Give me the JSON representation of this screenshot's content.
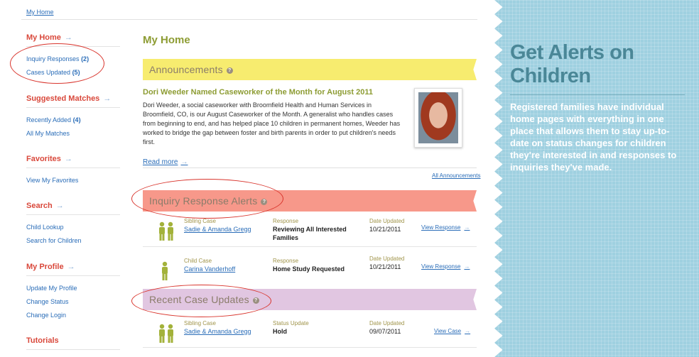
{
  "breadcrumb": "My Home",
  "sidebar": {
    "my_home": {
      "heading": "My Home",
      "links": [
        {
          "label": "Inquiry Responses",
          "count": "(2)"
        },
        {
          "label": "Cases Updated",
          "count": "(5)"
        }
      ]
    },
    "suggested": {
      "heading": "Suggested Matches",
      "links": [
        {
          "label": "Recently Added",
          "count": "(4)"
        },
        {
          "label": "All My Matches",
          "count": ""
        }
      ]
    },
    "favorites": {
      "heading": "Favorites",
      "links": [
        {
          "label": "View My Favorites"
        }
      ]
    },
    "search": {
      "heading": "Search",
      "links": [
        {
          "label": "Child Lookup"
        },
        {
          "label": "Search for Children"
        }
      ]
    },
    "profile": {
      "heading": "My Profile",
      "links": [
        {
          "label": "Update My Profile"
        },
        {
          "label": "Change Status"
        },
        {
          "label": "Change Login"
        }
      ]
    },
    "tutorials": {
      "heading": "Tutorials"
    },
    "arrow": "→"
  },
  "main": {
    "title": "My Home",
    "announcements": {
      "heading": "Announcements",
      "news_title": "Dori Weeder Named Caseworker of the Month for August 2011",
      "news_body": "Dori Weeder, a social caseworker with Broomfield Health and Human Services in Broomfield, CO, is our August Caseworker of the Month. A generalist who handles cases from beginning to end, and has helped place 10 children in permanent homes, Weeder has worked to bridge the gap between foster and birth parents in order to put children's needs first.",
      "read_more": "Read more",
      "all_link": "All Announcements"
    },
    "inquiry": {
      "heading": "Inquiry Response Alerts",
      "rows": [
        {
          "type": "Sibling Case",
          "name": "Sadie & Amanda Gregg",
          "col2_label": "Response",
          "col2_value": "Reviewing All Interested Families",
          "col3_label": "Date Updated",
          "col3_value": "10/21/2011",
          "action": "View Response"
        },
        {
          "type": "Child Case",
          "name": "Carina Vanderhoff",
          "col2_label": "Response",
          "col2_value": "Home Study Requested",
          "col3_label": "Date Updated",
          "col3_value": "10/21/2011",
          "action": "View Response"
        }
      ]
    },
    "recent": {
      "heading": "Recent Case Updates",
      "rows": [
        {
          "type": "Sibling Case",
          "name": "Sadie & Amanda Gregg",
          "col2_label": "Status Update",
          "col2_value": "Hold",
          "col3_label": "Date Updated",
          "col3_value": "09/07/2011",
          "action": "View Case"
        }
      ]
    },
    "help_glyph": "?"
  },
  "promo": {
    "title": "Get Alerts on Children",
    "body": "Registered families have individual home pages with everything in one place that allows them to stay up-to-date on status changes for children they're interested in and responses to inquiries they've made."
  },
  "colors": {
    "accent_red": "#d9483b",
    "title_green": "#8d9c33",
    "link_blue": "#2a6db8",
    "announce_yellow": "#f7ec6f",
    "inquiry_salmon": "#f7988a",
    "recent_lilac": "#e1c6e1",
    "promo_blue": "#9fd0e0",
    "highlight_red": "#d9352d"
  }
}
